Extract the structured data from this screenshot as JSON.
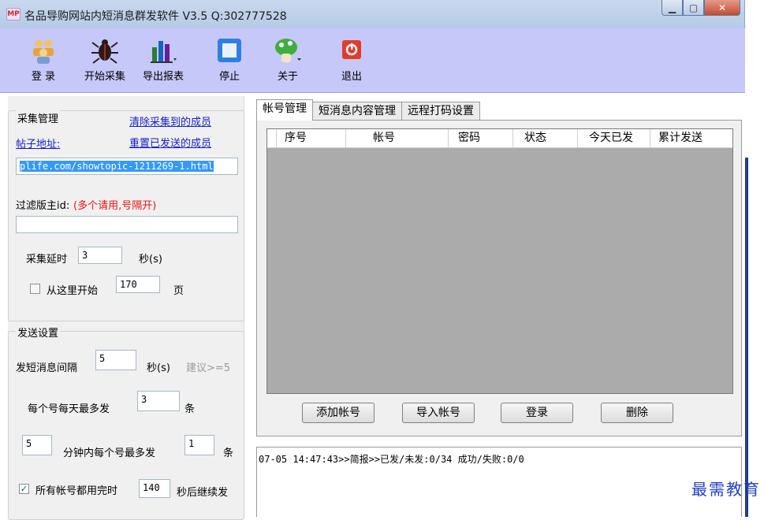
{
  "window": {
    "title": "名品导购网站内短消息群发软件 V3.5  Q:302777528",
    "icon": "mp-logo-icon",
    "controls": [
      "minimize",
      "maximize",
      "close"
    ]
  },
  "toolbar": {
    "login": "登 录",
    "start_collect": "开始采集",
    "export_report": "导出报表",
    "stop": "停止",
    "about": "关于",
    "exit": "退出"
  },
  "collect": {
    "title": "采集管理",
    "clear_link": "清除采集到的成员",
    "post_url_label": "帖子地址:",
    "reset_link": "重置已发送的成员",
    "url_value": "plife.com/showtopic-1211269-1.html",
    "filter_label": "过滤版主id:",
    "filter_hint": "(多个请用,号隔开)",
    "filter_value": "",
    "delay_label": "采集延时",
    "delay_value": "3",
    "delay_unit": "秒(s)",
    "start_here_label": "从这里开始",
    "start_here_checked": false,
    "start_page": "170",
    "page_unit": "页"
  },
  "send": {
    "title": "发送设置",
    "interval_label": "发短消息间隔",
    "interval_value": "5",
    "interval_unit": "秒(s)",
    "interval_hint": "建议>=5",
    "daily_label": "每个号每天最多发",
    "daily_value": "3",
    "daily_unit": "条",
    "minutes_value": "5",
    "per_minutes_label": "分钟内每个号最多发",
    "per_minutes_value": "1",
    "per_minutes_unit": "条",
    "all_done_label": "所有帐号都用完时",
    "all_done_checked": true,
    "resume_value": "140",
    "resume_label": "秒后继续发"
  },
  "tabs": [
    {
      "label": "帐号管理",
      "active": true
    },
    {
      "label": "短消息内容管理",
      "active": false
    },
    {
      "label": "远程打码设置",
      "active": false
    }
  ],
  "grid": {
    "columns": [
      "序号",
      "帐号",
      "密码",
      "状态",
      "今天已发",
      "累计发送"
    ],
    "rows": []
  },
  "buttons": {
    "add_account": "添加帐号",
    "import_account": "导入帐号",
    "login": "登录",
    "delete": "删除"
  },
  "log": {
    "line": "07-05 14:47:43>>简报>>已发/未发:0/34   成功/失败:0/0"
  },
  "watermark": "最需教育",
  "colors": {
    "toolbar_bg": "#c6c8fa",
    "link": "#1420c8",
    "hint_red": "#ee1111",
    "grid_bg": "#ababab",
    "selection": "#3399ff",
    "watermark": "#2140c2"
  }
}
